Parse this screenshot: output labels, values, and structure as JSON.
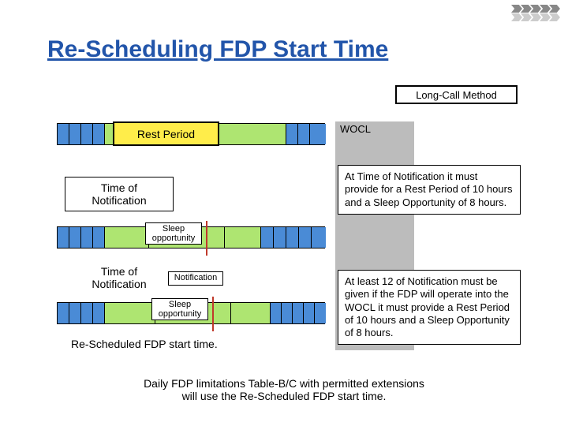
{
  "title": "Re-Scheduling FDP Start Time",
  "method_label": "Long-Call Method",
  "wocl": "WOCL",
  "rest_period": "Rest Period",
  "time_of_notification": "Time of\nNotification",
  "sleep_opportunity": "Sleep\nopportunity",
  "notification": "Notification",
  "rescheduled_caption": "Re-Scheduled FDP start time.",
  "info1": "At Time of Notification it must provide for a Rest Period of 10 hours and a Sleep Opportunity of 8 hours.",
  "info2": "At least 12 of Notification must be given if the FDP will operate into the WOCL it must provide a Rest Period of 10 hours and a Sleep Opportunity of 8 hours.",
  "footer": "Daily FDP limitations Table-B/C with permitted extensions\nwill use the Re-Scheduled FDP start time."
}
